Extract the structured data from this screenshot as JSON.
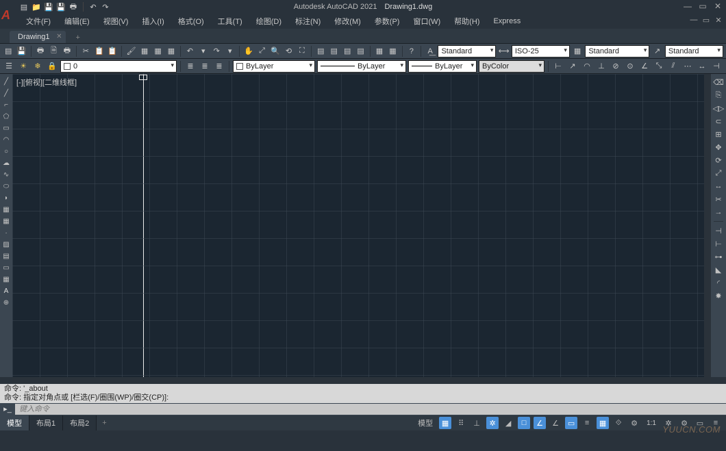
{
  "title": {
    "app": "Autodesk AutoCAD 2021",
    "file": "Drawing1.dwg"
  },
  "menubar": [
    "文件(F)",
    "编辑(E)",
    "视图(V)",
    "插入(I)",
    "格式(O)",
    "工具(T)",
    "绘图(D)",
    "标注(N)",
    "修改(M)",
    "参数(P)",
    "窗口(W)",
    "帮助(H)",
    "Express"
  ],
  "filetab": {
    "name": "Drawing1"
  },
  "dropdowns": {
    "textstyle": "Standard",
    "dimstyle": "ISO-25",
    "tablestyle": "Standard",
    "mlstyle": "Standard",
    "layer": "0",
    "linetype": "ByLayer",
    "lineweight": "ByLayer",
    "plotstyle": "ByLayer",
    "color": "ByColor"
  },
  "viewport_label": "[-][俯视][二维线框]",
  "cmd": {
    "line1": "命令: '_about",
    "line2": "命令: 指定对角点或 [栏选(F)/圈围(WP)/圈交(CP)]:",
    "placeholder": "键入命令"
  },
  "statusbar": {
    "tabs": [
      "模型",
      "布局1",
      "布局2"
    ],
    "model_btn": "模型",
    "scale": "1:1"
  },
  "watermark": "YUUCN.COM"
}
